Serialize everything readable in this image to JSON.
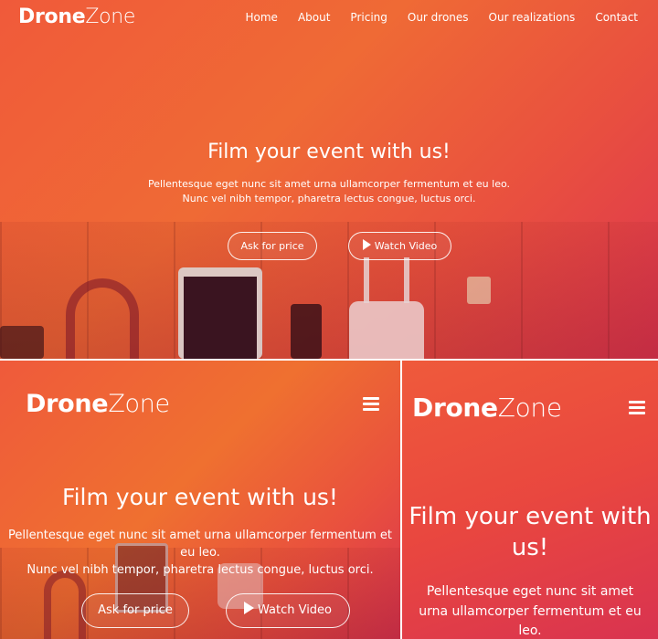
{
  "brand": {
    "bold": "Drone",
    "light": "Zone"
  },
  "nav": {
    "items": [
      "Home",
      "About",
      "Pricing",
      "Our drones",
      "Our realizations",
      "Contact"
    ]
  },
  "hero": {
    "title": "Film your event with us!",
    "text_line1": "Pellentesque eget nunc sit amet urna ullamcorper fermentum et eu leo.",
    "text_line2": "Nunc vel nibh tempor, pharetra lectus congue, luctus orci.",
    "ask_label": "Ask for price",
    "watch_label": "Watch Video"
  },
  "mobile_right": {
    "title_line1": "Film your event with",
    "title_line2": "us!",
    "text_line1": "Pellentesque eget nunc sit amet",
    "text_line2": "urna ullamcorper fermentum et eu",
    "text_line3": "leo."
  },
  "colors": {
    "accent_top": "#f45c3c",
    "accent_bottom": "#d6314e",
    "orange": "#ef7a2a"
  },
  "icons": {
    "menu": "hamburger-icon",
    "play": "play-icon"
  }
}
